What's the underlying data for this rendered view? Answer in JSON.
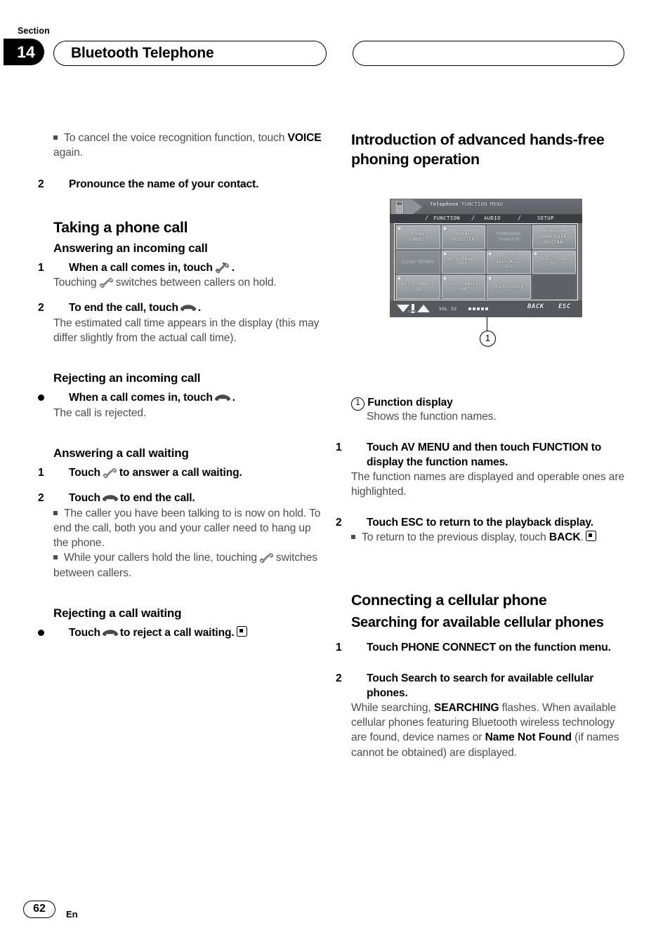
{
  "header": {
    "section_label": "Section",
    "section_number": "14",
    "title": "Bluetooth Telephone"
  },
  "footer": {
    "page_number": "62",
    "language": "En"
  },
  "left_column": {
    "note_cancel_voice": {
      "text_1": "To cancel the voice recognition function, touch ",
      "bold": "VOICE",
      "text_2": " again."
    },
    "step_pronounce": {
      "num": "2",
      "text": "Pronounce the name of your contact."
    },
    "taking_a_phone_call": {
      "heading": "Taking a phone call",
      "answering_incoming": {
        "heading": "Answering an incoming call",
        "step1_num": "1",
        "step1_text_1": "When a call comes in, touch",
        "step1_text_2": ".",
        "body_1": "Touching",
        "body_2": "switches between callers on hold.",
        "step2_num": "2",
        "step2_text_1": "To end the call, touch",
        "step2_text_2": ".",
        "body2": "The estimated call time appears in the display (this may differ slightly from the actual call time)."
      },
      "rejecting_incoming": {
        "heading": "Rejecting an incoming call",
        "bullet_text_1": "When a call comes in, touch",
        "bullet_text_2": ".",
        "body": "The call is rejected."
      },
      "answering_call_waiting": {
        "heading": "Answering a call waiting",
        "step1_num": "1",
        "step1_text_1": "Touch",
        "step1_text_2": "to answer a call waiting.",
        "step2_num": "2",
        "step2_text_1": "Touch",
        "step2_text_2": "to end the call.",
        "note1": "The caller you have been talking to is now on hold. To end the call, both you and your caller need to hang up the phone.",
        "note2_text_1": "While your callers hold the line, touching",
        "note2_text_2": "switches between callers."
      },
      "rejecting_call_waiting": {
        "heading": "Rejecting a call waiting",
        "bullet_text_1": "Touch",
        "bullet_text_2": "to reject a call waiting."
      }
    }
  },
  "right_column": {
    "intro_heading": "Introduction of advanced hands-free phoning operation",
    "callout": {
      "marker": "1",
      "label": "Function display",
      "description": "Shows the function names."
    },
    "step1": {
      "num": "1",
      "text": "Touch AV MENU and then touch FUNCTION to display the function names.",
      "body": "The function names are displayed and operable ones are highlighted."
    },
    "step2": {
      "num": "2",
      "text": "Touch ESC to return to the playback display.",
      "note_text_1": "To return to the previous display, touch ",
      "note_bold": "BACK",
      "note_text_2": "."
    },
    "connecting_heading": "Connecting a cellular phone",
    "searching_heading": "Searching for available cellular phones",
    "search_step1": {
      "num": "1",
      "text": "Touch PHONE CONNECT on the function menu."
    },
    "search_step2": {
      "num": "2",
      "text": "Touch Search to search for available cellular phones.",
      "body_1": "While searching, ",
      "body_bold_1": "SEARCHING",
      "body_2": " flashes. When available cellular phones featuring Bluetooth wireless technology are found, device names or ",
      "body_bold_2": "Name Not Found",
      "body_3": " (if names cannot be obtained) are displayed."
    }
  },
  "device_screen": {
    "title_italic": "Telephone",
    "title_rest": "FUNCTION MENU",
    "tabs": [
      "FUNCTION",
      "AUDIO",
      "SETUP"
    ],
    "buttons": [
      {
        "label": "PHONE\nCONNECT",
        "state": "active"
      },
      {
        "label": "PHONE\nREGISTER",
        "state": "active"
      },
      {
        "label": "PHONEBOOK\nTRANSFER",
        "state": "dim"
      },
      {
        "label": "PHONEBOOK\nNAME VIEW\nORIGINAL",
        "state": "active"
      },
      {
        "label": "CLEAR MEMORY",
        "state": "dim"
      },
      {
        "label": "AUTO ANSWER\nOFF",
        "state": "active"
      },
      {
        "label": "REFUSE\nALL CALLS\nOFF",
        "state": "active"
      },
      {
        "label": "RING TONE\nOFF",
        "state": "active"
      },
      {
        "label": "AUTO CONNECT\nON",
        "state": "active"
      },
      {
        "label": "ECHO CANCEL\nON",
        "state": "active"
      },
      {
        "label": "DEVICE INFO",
        "state": "active"
      },
      {
        "label": "",
        "state": "empty"
      }
    ],
    "tilt_label": "TILT",
    "volume_label": "VOL 32",
    "softkey_back": "BACK",
    "softkey_esc": "ESC"
  },
  "colors": {
    "body_text": "#4d4d4d",
    "heading_text": "#000000",
    "device_bg": "#6f7276",
    "device_button": "#a2a7ab"
  }
}
